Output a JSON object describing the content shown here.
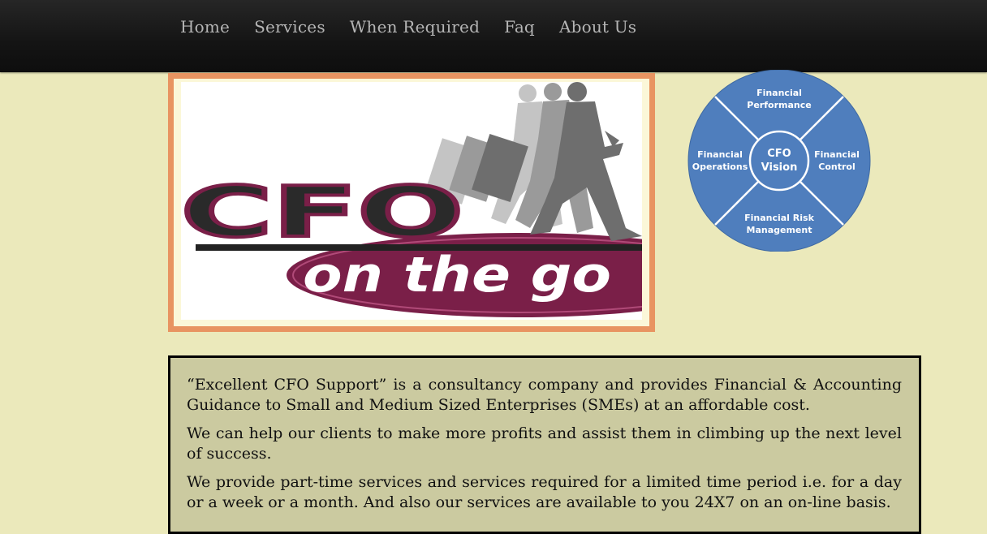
{
  "nav": {
    "items": [
      {
        "label": "Home"
      },
      {
        "label": "Services"
      },
      {
        "label": "When Required"
      },
      {
        "label": "Faq"
      },
      {
        "label": "About Us"
      }
    ]
  },
  "logo": {
    "line1": "CFO",
    "line2": "on the go",
    "frame_color": "#e89461",
    "accent_color": "#7a1f48"
  },
  "wheel": {
    "center_line1": "CFO",
    "center_line2": "Vision",
    "top_line1": "Financial",
    "top_line2": "Performance",
    "left_line1": "Financial",
    "left_line2": "Operations",
    "right_line1": "Financial",
    "right_line2": "Control",
    "bottom_line1": "Financial Risk",
    "bottom_line2": "Management",
    "color": "#4f7ebd"
  },
  "content": {
    "paragraphs": [
      "“Excellent CFO Support” is a consultancy company and provides Financial & Accounting Guidance to Small and Medium Sized Enterprises (SMEs) at an affordable cost.",
      "We can help our clients to make more profits and assist them in climbing up the next level of success.",
      "We provide part-time services and services required for a limited time period i.e. for a day or a week or a month. And also our services are available to you 24X7 on an on-line basis."
    ]
  }
}
